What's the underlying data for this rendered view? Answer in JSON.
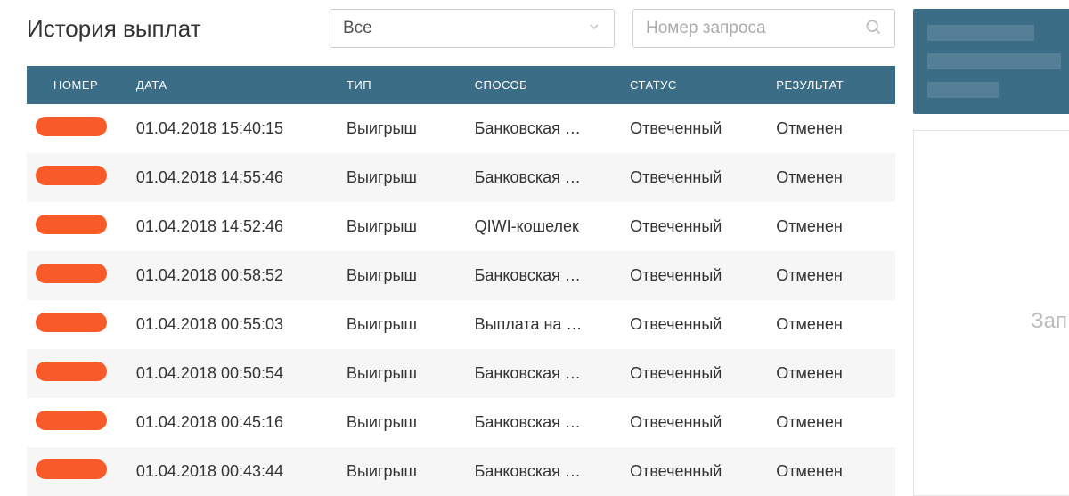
{
  "header": {
    "title": "История выплат",
    "filter_selected": "Все",
    "search_placeholder": "Номер запроса"
  },
  "table": {
    "columns": {
      "number": "НОМЕР",
      "date": "ДАТА",
      "type": "ТИП",
      "method": "СПОСОБ",
      "status": "СТАТУС",
      "result": "РЕЗУЛЬТАТ"
    },
    "rows": [
      {
        "date": "01.04.2018 15:40:15",
        "type": "Выигрыш",
        "method": "Банковская …",
        "status": "Отвеченный",
        "result": "Отменен"
      },
      {
        "date": "01.04.2018 14:55:46",
        "type": "Выигрыш",
        "method": "Банковская …",
        "status": "Отвеченный",
        "result": "Отменен"
      },
      {
        "date": "01.04.2018 14:52:46",
        "type": "Выигрыш",
        "method": "QIWI-кошелек",
        "status": "Отвеченный",
        "result": "Отменен"
      },
      {
        "date": "01.04.2018 00:58:52",
        "type": "Выигрыш",
        "method": "Банковская …",
        "status": "Отвеченный",
        "result": "Отменен"
      },
      {
        "date": "01.04.2018 00:55:03",
        "type": "Выигрыш",
        "method": "Выплата на …",
        "status": "Отвеченный",
        "result": "Отменен"
      },
      {
        "date": "01.04.2018 00:50:54",
        "type": "Выигрыш",
        "method": "Банковская …",
        "status": "Отвеченный",
        "result": "Отменен"
      },
      {
        "date": "01.04.2018 00:45:16",
        "type": "Выигрыш",
        "method": "Банковская …",
        "status": "Отвеченный",
        "result": "Отменен"
      },
      {
        "date": "01.04.2018 00:43:44",
        "type": "Выигрыш",
        "method": "Банковская …",
        "status": "Отвеченный",
        "result": "Отменен"
      }
    ]
  },
  "sidebar": {
    "hint_fragment": "Зап"
  }
}
